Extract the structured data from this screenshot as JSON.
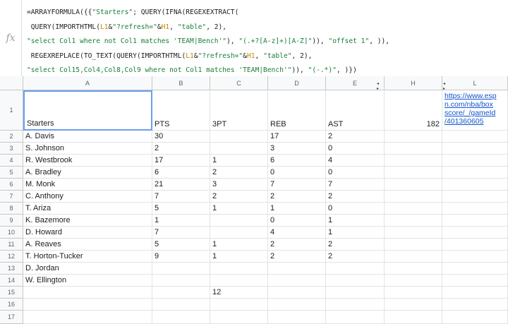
{
  "formula_bar": {
    "fx_label": "fx",
    "lines": [
      [
        {
          "t": "=ARRAYFORMULA({{"
        },
        {
          "t": "\"Starters\"",
          "c": "s"
        },
        {
          "t": "; QUERY(IFNA(REGEXEXTRACT("
        }
      ],
      [
        {
          "t": " QUERY(IMPORTHTML("
        },
        {
          "t": "L1",
          "c": "ref"
        },
        {
          "t": "&"
        },
        {
          "t": "\"?refresh=\"",
          "c": "s"
        },
        {
          "t": "&"
        },
        {
          "t": "H1",
          "c": "ref"
        },
        {
          "t": ", "
        },
        {
          "t": "\"table\"",
          "c": "s"
        },
        {
          "t": ", 2),"
        }
      ],
      [
        {
          "t": "\"select Col1 where not Col1 matches 'TEAM|Bench'\"",
          "c": "s"
        },
        {
          "t": "), "
        },
        {
          "t": "\"(.+?[A-z]+)[A-Z]\"",
          "c": "s"
        },
        {
          "t": ")), "
        },
        {
          "t": "\"offset 1\"",
          "c": "s"
        },
        {
          "t": ", )),"
        }
      ],
      [
        {
          "t": " REGEXREPLACE(TO_TEXT(QUERY(IMPORTHTML("
        },
        {
          "t": "L1",
          "c": "ref"
        },
        {
          "t": "&"
        },
        {
          "t": "\"?refresh=\"",
          "c": "s"
        },
        {
          "t": "&"
        },
        {
          "t": "H1",
          "c": "ref"
        },
        {
          "t": ", "
        },
        {
          "t": "\"table\"",
          "c": "s"
        },
        {
          "t": ", 2),"
        }
      ],
      [
        {
          "t": "\"select Col15,Col4,Col8,Col9 where not Col1 matches 'TEAM|Bench'\"",
          "c": "s"
        },
        {
          "t": ")), "
        },
        {
          "t": "\"(-.*)\"",
          "c": "s"
        },
        {
          "t": ", )})"
        }
      ]
    ]
  },
  "columns": [
    "A",
    "B",
    "C",
    "D",
    "E",
    "H",
    "L"
  ],
  "row_numbers": [
    "1",
    "2",
    "3",
    "4",
    "5",
    "6",
    "7",
    "8",
    "9",
    "10",
    "11",
    "12",
    "13",
    "14",
    "15",
    "16",
    "17"
  ],
  "rows": [
    [
      "Starters",
      "PTS",
      "3PT",
      "REB",
      "AST",
      "182",
      ""
    ],
    [
      "A. Davis",
      "30",
      "",
      "17",
      "2",
      "",
      ""
    ],
    [
      "S. Johnson",
      "2",
      "",
      "3",
      "0",
      "",
      ""
    ],
    [
      "R. Westbrook",
      "17",
      "1",
      "6",
      "4",
      "",
      ""
    ],
    [
      "A. Bradley",
      "6",
      "2",
      "0",
      "0",
      "",
      ""
    ],
    [
      "M. Monk",
      "21",
      "3",
      "7",
      "7",
      "",
      ""
    ],
    [
      "C. Anthony",
      "7",
      "2",
      "2",
      "2",
      "",
      ""
    ],
    [
      "T. Ariza",
      "5",
      "1",
      "1",
      "0",
      "",
      ""
    ],
    [
      "K. Bazemore",
      "1",
      "",
      "0",
      "1",
      "",
      ""
    ],
    [
      "D. Howard",
      "7",
      "",
      "4",
      "1",
      "",
      ""
    ],
    [
      "A. Reaves",
      "5",
      "1",
      "2",
      "2",
      "",
      ""
    ],
    [
      "T. Horton-Tucker",
      "9",
      "1",
      "2",
      "2",
      "",
      ""
    ],
    [
      "D. Jordan",
      "",
      "",
      "",
      "",
      "",
      ""
    ],
    [
      "W. Ellington",
      "",
      "",
      "",
      "",
      "",
      ""
    ],
    [
      "",
      "",
      "12",
      "",
      "",
      "",
      ""
    ],
    [
      "",
      "",
      "",
      "",
      "",
      "",
      ""
    ],
    [
      "",
      "",
      "",
      "",
      "",
      "",
      ""
    ]
  ],
  "link_cell": "https://www.espn.com/nba/boxscore/_/gameId/401360605",
  "link_display": "https://www.esp n.com/nba/box score/_/gameId /401360605",
  "hidden_column_markers": [
    "◂ ▸",
    "◂ ▸"
  ]
}
